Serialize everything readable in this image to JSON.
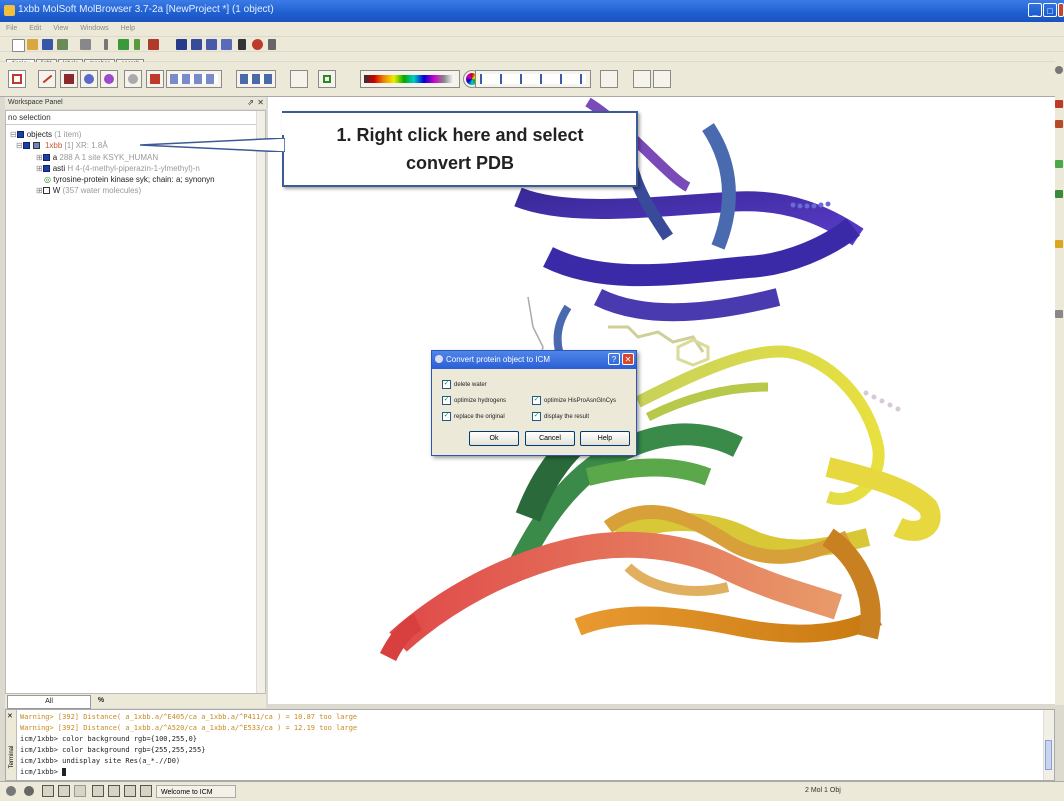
{
  "window": {
    "title": "1xbb MolSoft MolBrowser 3.7-2a [NewProject *] (1 object)",
    "buttons": [
      "minimize",
      "maximize",
      "close"
    ]
  },
  "menubar": {
    "items": [
      "File",
      "Edit",
      "View",
      "Windows",
      "Help"
    ]
  },
  "display_tabs": [
    "display",
    "light",
    "labels",
    "meshes",
    "search"
  ],
  "workspace": {
    "title": "Workspace Panel",
    "selection": "no selection",
    "tree": {
      "root_label": "objects",
      "root_count": "(1 item)",
      "object_name": "1xbb",
      "object_info": "[1] XR: 1.8Å",
      "children": [
        {
          "name": "a",
          "info": "288 A  1 site KSYK_HUMAN"
        },
        {
          "name": "asti",
          "info": "H  4-(4-methyl-piperazin-1-ylmethyl)-n"
        },
        {
          "name": "tyrosine-protein kinase syk; chain: a; synonyn",
          "info": ""
        },
        {
          "name": "W",
          "info": "(357 water molecules)"
        }
      ]
    },
    "bottom_tabs": [
      "All",
      "%"
    ]
  },
  "callout": {
    "line1": "1. Right click here and select",
    "line2": "convert PDB"
  },
  "dialog": {
    "title": "Convert protein object to ICM",
    "options": [
      {
        "label": "delete water",
        "checked": true
      },
      {
        "label": "optimize hydrogens",
        "checked": true
      },
      {
        "label": "optimize HisProAsnGlnCys",
        "checked": true
      },
      {
        "label": "replace the original",
        "checked": true
      },
      {
        "label": "display the result",
        "checked": true
      }
    ],
    "buttons": {
      "ok": "Ok",
      "cancel": "Cancel",
      "help": "Help"
    }
  },
  "console": {
    "label": "Terminal",
    "lines": [
      {
        "text": "Warning> [392] Distance( a_1xbb.a/^E405/ca a_1xbb.a/^P411/ca ) = 10.87 too large",
        "color": "#c88a20"
      },
      {
        "text": "Warning> [392] Distance( a_1xbb.a/^A520/ca a_1xbb.a/^E533/ca ) = 12.19 too large",
        "color": "#c88a20"
      },
      {
        "text": "icm/1xbb> color background rgb={100,255,0}",
        "color": "#222222"
      },
      {
        "text": "icm/1xbb> color background rgb={255,255,255}",
        "color": "#222222"
      },
      {
        "text": "icm/1xbb> undisplay site Res(a_*.//D0)",
        "color": "#222222"
      },
      {
        "text": "icm/1xbb> ",
        "color": "#222222"
      }
    ]
  },
  "status": {
    "welcome": "Welcome to ICM",
    "right": "2 Mol 1 Obj"
  },
  "colors": {
    "titlebar": "#2360d3",
    "accent": "#3c5a96",
    "object_icon": "#1c3fa0"
  }
}
